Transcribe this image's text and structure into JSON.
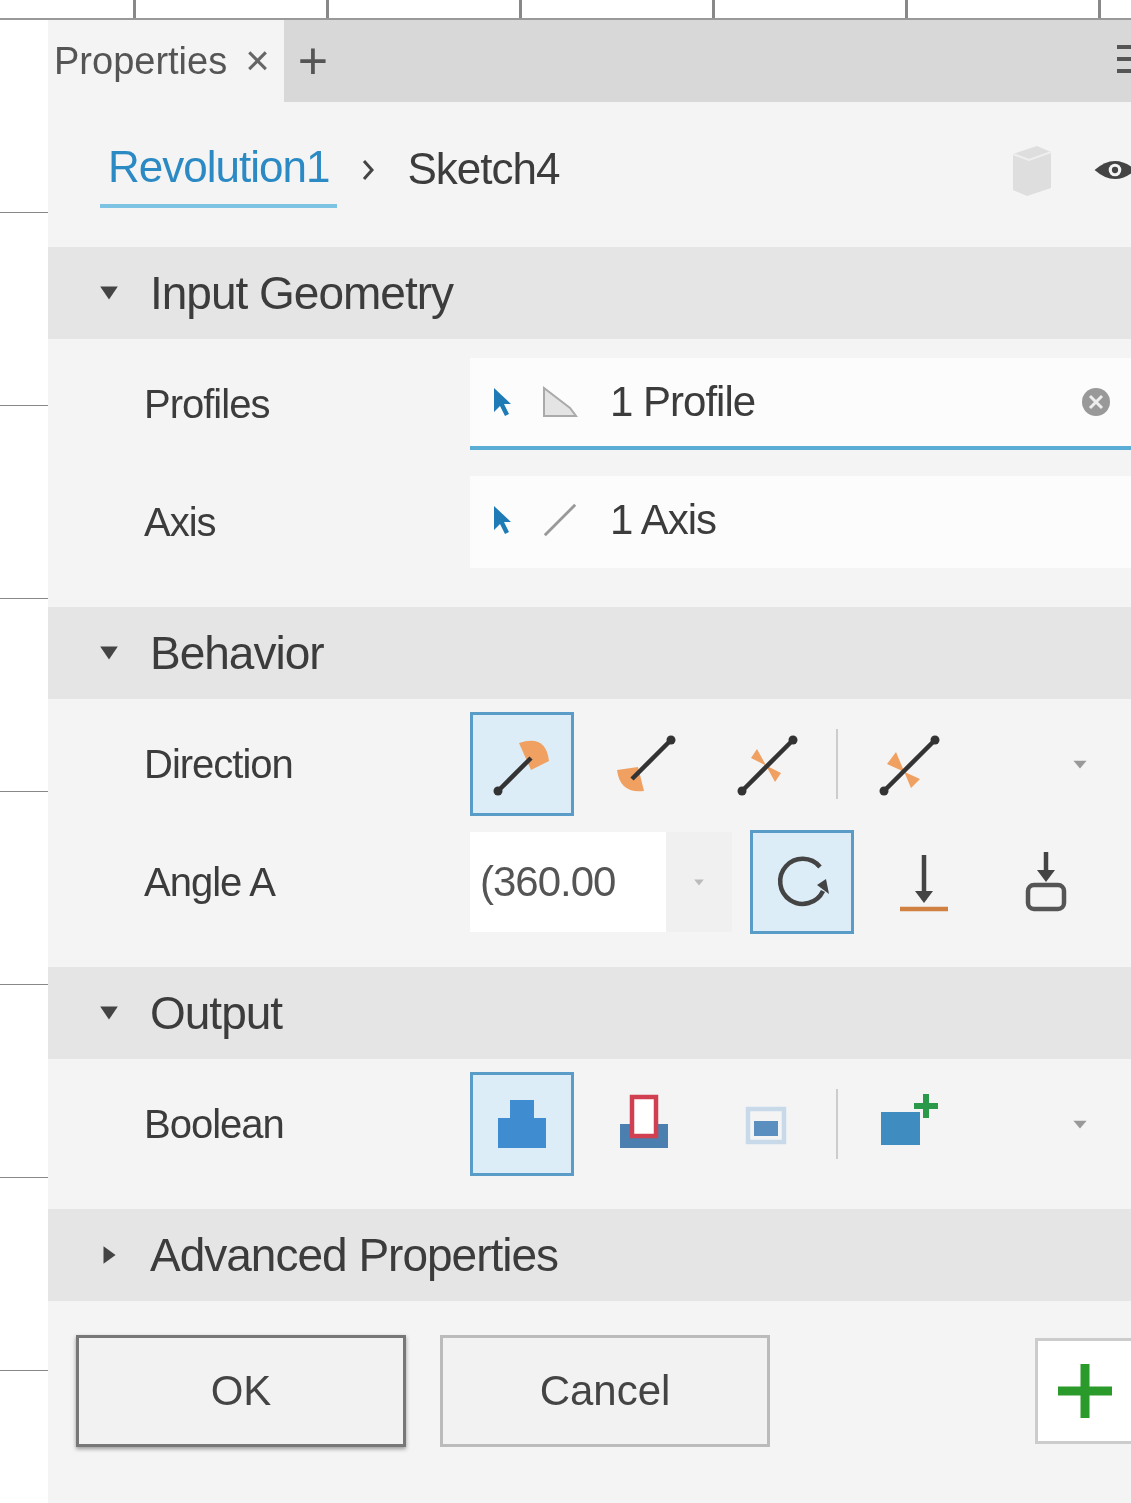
{
  "tab": {
    "label": "Properties",
    "close": "×",
    "add": "+"
  },
  "breadcrumb": [
    {
      "label": "Revolution1",
      "selected": true
    },
    {
      "label": "Sketch4",
      "selected": false
    }
  ],
  "sections": [
    {
      "title": "Input Geometry",
      "expanded": true,
      "rows": [
        {
          "kind": "selector",
          "label": "Profiles",
          "value": "1 Profile",
          "active": true
        },
        {
          "kind": "selector",
          "label": "Axis",
          "value": "1 Axis",
          "active": false
        }
      ]
    },
    {
      "title": "Behavior",
      "expanded": true,
      "rows": [
        {
          "kind": "direction",
          "label": "Direction",
          "options": [
            {
              "selected": true
            },
            {
              "selected": false
            },
            {
              "selected": false
            },
            {
              "selected": false
            }
          ]
        },
        {
          "kind": "angle",
          "label": "Angle A",
          "value": "(360.00",
          "options": [
            {
              "selected": true
            },
            {
              "selected": false
            },
            {
              "selected": false
            }
          ]
        }
      ]
    },
    {
      "title": "Output",
      "expanded": true,
      "rows": [
        {
          "kind": "boolean",
          "label": "Boolean",
          "options": [
            {
              "selected": true
            },
            {
              "selected": false
            },
            {
              "selected": false
            },
            {
              "selected": false
            }
          ]
        }
      ]
    },
    {
      "title": "Advanced Properties",
      "expanded": false
    }
  ],
  "buttons": [
    {
      "label": "OK",
      "kind": "primary"
    },
    {
      "label": "Cancel",
      "kind": "secondary"
    }
  ]
}
